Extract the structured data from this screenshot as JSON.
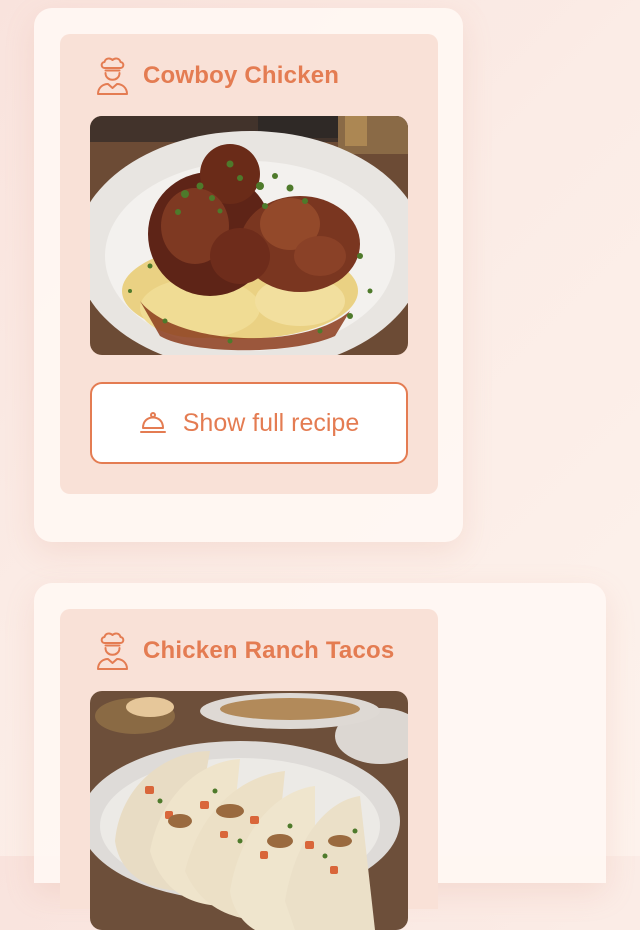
{
  "recipes": [
    {
      "title": "Cowboy Chicken",
      "image_alt": "Fried chicken over mashed potatoes with gravy and herbs",
      "button_label": "Show full recipe"
    },
    {
      "title": "Chicken Ranch Tacos",
      "image_alt": "Chicken tacos with tomatoes and herbs on a plate"
    }
  ],
  "icons": {
    "chef": "chef-icon",
    "cloche": "cloche-icon"
  },
  "colors": {
    "accent": "#e47c52",
    "inner_card": "#f9e1d7",
    "outer_card": "#fff7f3",
    "button_background": "#ffffff"
  }
}
